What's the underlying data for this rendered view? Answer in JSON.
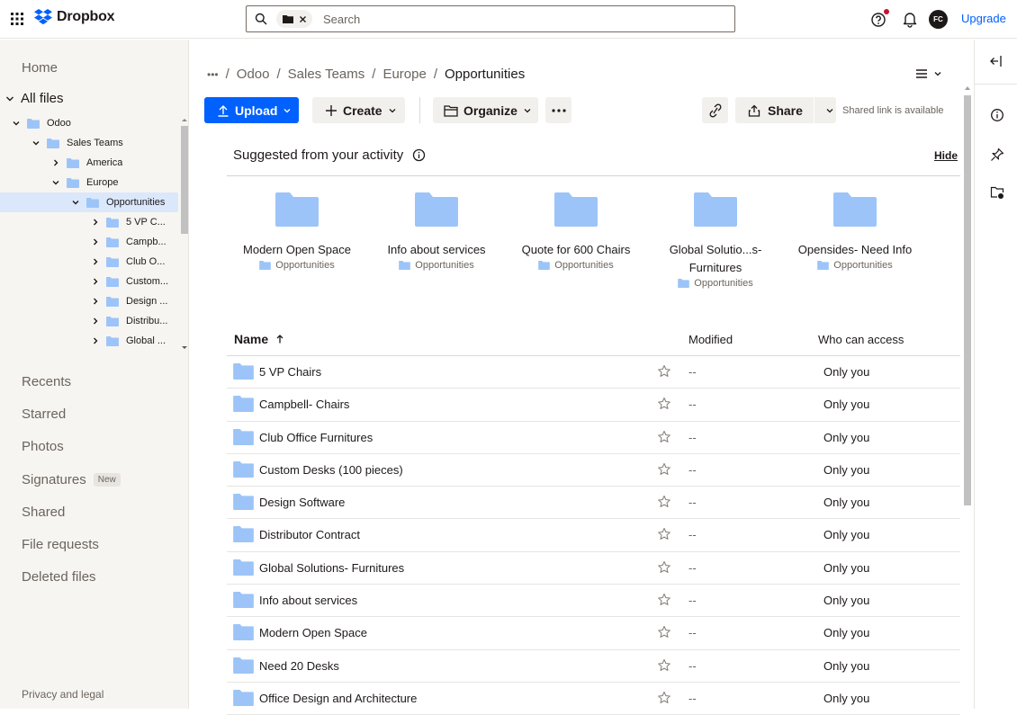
{
  "topbar": {
    "brand": "Dropbox",
    "search": {
      "placeholder": "Search",
      "chip_icon": "folder-icon"
    },
    "avatar_initials": "FC",
    "upgrade_label": "Upgrade"
  },
  "sidebar": {
    "home": "Home",
    "all_files": "All files",
    "tree": [
      {
        "label": "Odoo",
        "depth": 0,
        "expanded": true,
        "selected": false
      },
      {
        "label": "Sales Teams",
        "depth": 1,
        "expanded": true,
        "selected": false
      },
      {
        "label": "America",
        "depth": 2,
        "expanded": false,
        "selected": false
      },
      {
        "label": "Europe",
        "depth": 2,
        "expanded": true,
        "selected": false
      },
      {
        "label": "Opportunities",
        "depth": 3,
        "expanded": true,
        "selected": true
      },
      {
        "label": "5 VP C...",
        "depth": 4,
        "expanded": false,
        "selected": false
      },
      {
        "label": "Campb...",
        "depth": 4,
        "expanded": false,
        "selected": false
      },
      {
        "label": "Club O...",
        "depth": 4,
        "expanded": false,
        "selected": false
      },
      {
        "label": "Custom...",
        "depth": 4,
        "expanded": false,
        "selected": false
      },
      {
        "label": "Design ...",
        "depth": 4,
        "expanded": false,
        "selected": false
      },
      {
        "label": "Distribu...",
        "depth": 4,
        "expanded": false,
        "selected": false
      },
      {
        "label": "Global ...",
        "depth": 4,
        "expanded": false,
        "selected": false
      }
    ],
    "nav": [
      {
        "label": "Recents"
      },
      {
        "label": "Starred"
      },
      {
        "label": "Photos"
      },
      {
        "label": "Signatures",
        "badge": "New"
      },
      {
        "label": "Shared"
      },
      {
        "label": "File requests"
      },
      {
        "label": "Deleted files"
      }
    ],
    "privacy": "Privacy and legal"
  },
  "breadcrumb": {
    "ellipsis": "•••",
    "items": [
      "Odoo",
      "Sales Teams",
      "Europe"
    ],
    "current": "Opportunities"
  },
  "toolbar": {
    "upload": "Upload",
    "create": "Create",
    "organize": "Organize",
    "share": "Share",
    "shared_status": "Shared link is available"
  },
  "suggested": {
    "title": "Suggested from your activity",
    "hide": "Hide",
    "cards": [
      {
        "name": "Modern Open Space",
        "location": "Opportunities"
      },
      {
        "name": "Info about services",
        "location": "Opportunities"
      },
      {
        "name": "Quote for 600 Chairs",
        "location": "Opportunities"
      },
      {
        "name": "Global Solutio...s-Furnitures",
        "location": "Opportunities"
      },
      {
        "name": "Opensides- Need Info",
        "location": "Opportunities"
      }
    ]
  },
  "table": {
    "headers": {
      "name": "Name",
      "modified": "Modified",
      "access": "Who can access"
    },
    "rows": [
      {
        "name": "5 VP Chairs",
        "modified": "--",
        "access": "Only you"
      },
      {
        "name": "Campbell- Chairs",
        "modified": "--",
        "access": "Only you"
      },
      {
        "name": "Club Office Furnitures",
        "modified": "--",
        "access": "Only you"
      },
      {
        "name": "Custom Desks (100 pieces)",
        "modified": "--",
        "access": "Only you"
      },
      {
        "name": "Design Software",
        "modified": "--",
        "access": "Only you"
      },
      {
        "name": "Distributor Contract",
        "modified": "--",
        "access": "Only you"
      },
      {
        "name": "Global Solutions- Furnitures",
        "modified": "--",
        "access": "Only you"
      },
      {
        "name": "Info about services",
        "modified": "--",
        "access": "Only you"
      },
      {
        "name": "Modern Open Space",
        "modified": "--",
        "access": "Only you"
      },
      {
        "name": "Need 20 Desks",
        "modified": "--",
        "access": "Only you"
      },
      {
        "name": "Office Design and Architecture",
        "modified": "--",
        "access": "Only you"
      }
    ]
  },
  "colors": {
    "accent": "#0061fe",
    "folder": "#9cc4f8",
    "selected_row": "#dbe8fc",
    "sidebar_bg": "#f7f5f2"
  }
}
